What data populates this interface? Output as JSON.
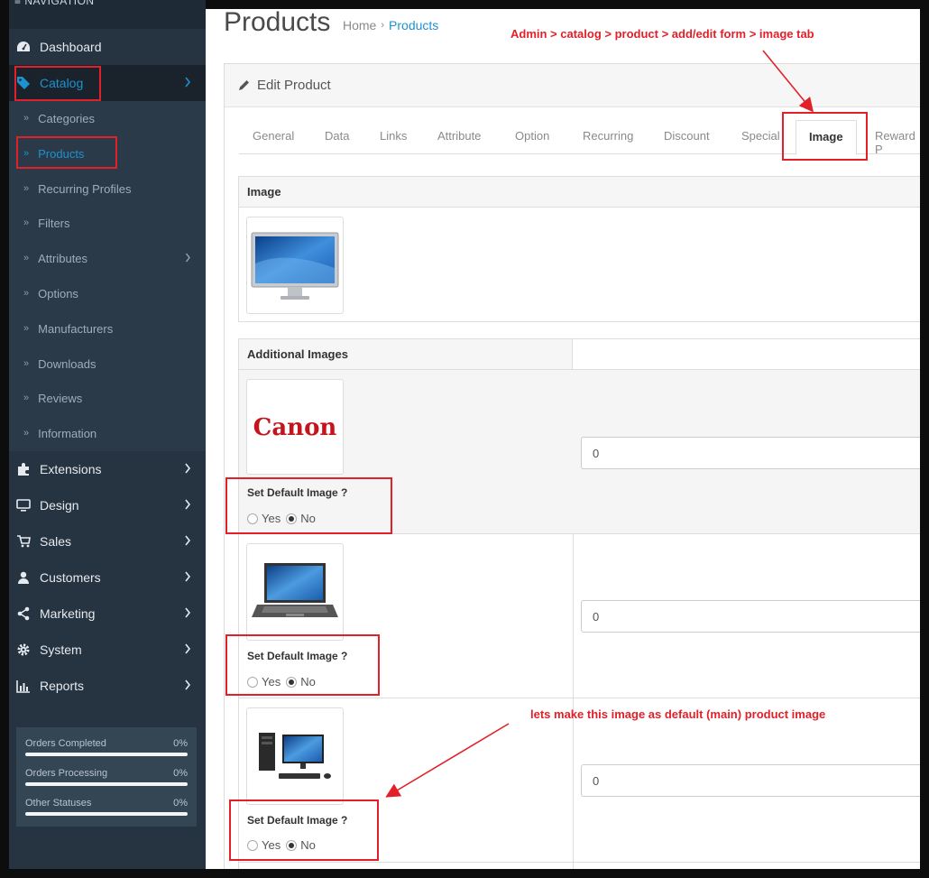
{
  "sidebar": {
    "header": "≡ NAVIGATION",
    "items": [
      {
        "label": "Dashboard",
        "icon": "dashboard-icon"
      },
      {
        "label": "Catalog",
        "icon": "tags-icon"
      },
      {
        "label": "Extensions",
        "icon": "puzzle-icon"
      },
      {
        "label": "Design",
        "icon": "monitor-icon"
      },
      {
        "label": "Sales",
        "icon": "cart-icon"
      },
      {
        "label": "Customers",
        "icon": "user-icon"
      },
      {
        "label": "Marketing",
        "icon": "share-icon"
      },
      {
        "label": "System",
        "icon": "gear-icon"
      },
      {
        "label": "Reports",
        "icon": "bar-chart-icon"
      }
    ],
    "catalog_sub": [
      "Categories",
      "Products",
      "Recurring Profiles",
      "Filters",
      "Attributes",
      "Options",
      "Manufacturers",
      "Downloads",
      "Reviews",
      "Information"
    ],
    "stats": [
      {
        "label": "Orders Completed",
        "value": "0%"
      },
      {
        "label": "Orders Processing",
        "value": "0%"
      },
      {
        "label": "Other Statuses",
        "value": "0%"
      }
    ]
  },
  "header": {
    "title": "Products",
    "breadcrumb": [
      "Home",
      "Products"
    ]
  },
  "panel": {
    "title": "Edit Product",
    "tabs": [
      "General",
      "Data",
      "Links",
      "Attribute",
      "Option",
      "Recurring",
      "Discount",
      "Special",
      "Image",
      "Reward P"
    ],
    "active_tab": "Image",
    "image_header": "Image",
    "additional_header": "Additional Images",
    "default_label": "Set Default Image ?",
    "yes": "Yes",
    "no": "No",
    "rows": [
      {
        "brand": "Canon",
        "sort_order": "0"
      },
      {
        "brand": "",
        "sort_order": "0"
      },
      {
        "brand": "",
        "sort_order": "0"
      }
    ]
  },
  "annotations": {
    "path_note": "Admin > catalog > product > add/edit form > image tab",
    "default_note": "lets make this image as default (main) product image"
  },
  "colors": {
    "accent": "#1e91cf",
    "annotation": "#e2202a",
    "sidebar": "#263442"
  }
}
